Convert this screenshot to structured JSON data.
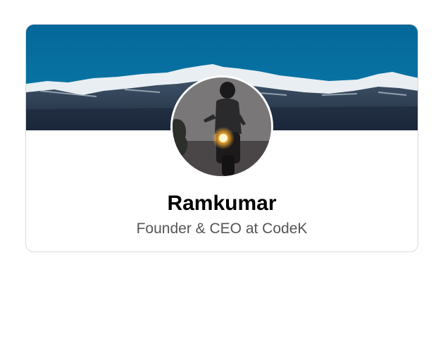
{
  "profile": {
    "name": "Ramkumar",
    "title": "Founder & CEO at CodeK"
  },
  "cover": {
    "image": "snowy-mountain-range-cover",
    "sky_color": "#0a6e9c"
  },
  "avatar": {
    "image": "rider-on-motorcycle-photo"
  }
}
